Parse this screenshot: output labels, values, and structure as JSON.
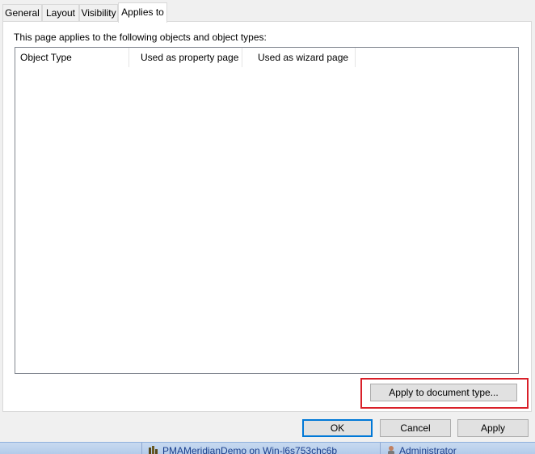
{
  "tabs": [
    {
      "label": "General"
    },
    {
      "label": "Layout"
    },
    {
      "label": "Visibility"
    },
    {
      "label": "Applies to"
    }
  ],
  "active_tab": "Applies to",
  "panel": {
    "description": "This page applies to the following objects and object types:",
    "columns": [
      {
        "label": "Object Type"
      },
      {
        "label": "Used as property page"
      },
      {
        "label": "Used as wizard page"
      }
    ],
    "rows": [],
    "apply_doc_type_label": "Apply to document type..."
  },
  "buttons": {
    "ok": "OK",
    "cancel": "Cancel",
    "apply": "Apply"
  },
  "taskbar": {
    "server_item": "PMAMeridianDemo on Win-l6s753chc6b",
    "user_item": "Administrator"
  },
  "colors": {
    "highlight_border": "#d92029",
    "default_button_border": "#0078d7"
  }
}
